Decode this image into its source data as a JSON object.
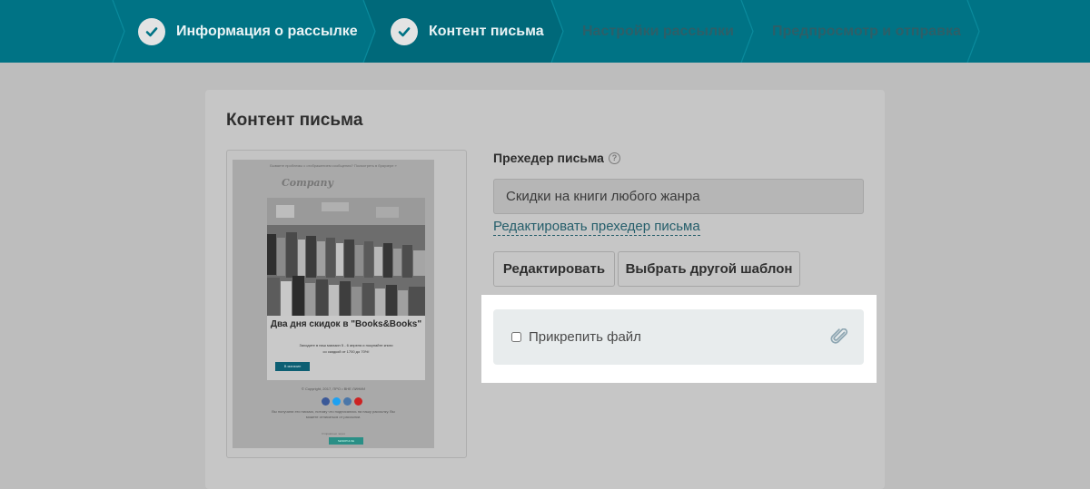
{
  "stepper": {
    "steps": [
      {
        "label": "Информация о рассылке",
        "state": "done"
      },
      {
        "label": "Контент письма",
        "state": "current"
      },
      {
        "label": "Настройки рассылки",
        "state": "todo"
      },
      {
        "label": "Предпросмотр и отправка",
        "state": "todo"
      }
    ],
    "colors": {
      "bar": "#007385",
      "current": "#00697a"
    }
  },
  "content": {
    "title": "Контент письма",
    "preheader": {
      "label": "Прехедер письма",
      "value": "Скидки на книги любого жанра",
      "edit_link": "Редактировать прехедер письма"
    },
    "buttons": {
      "edit": "Редактировать",
      "choose_template": "Выбрать другой шаблон"
    },
    "attach": {
      "label": "Прикрепить файл",
      "checked": false
    }
  },
  "preview": {
    "top_text": "Бываете проблемы с отображением сообщения? Посмотреть в браузере »",
    "logo": "Company",
    "headline": "Два дня скидок в \"Books&Books\"",
    "sub_line1": "Заходите в наш магазин 5 - 6 апреля и покупайте книги",
    "sub_line2": "со скидкой от 1700 до 70%!",
    "button": "В магазин",
    "copyright": "© Copyright, 2017, ПРО • ВНЕ ЛИНИИ",
    "unsubscribe": "Вы получили это письмо, потому что подписались на нашу рассылку. Вы можете отписаться от рассылки.",
    "powered": "Отправлено через",
    "badge": "SENDPULSE"
  }
}
